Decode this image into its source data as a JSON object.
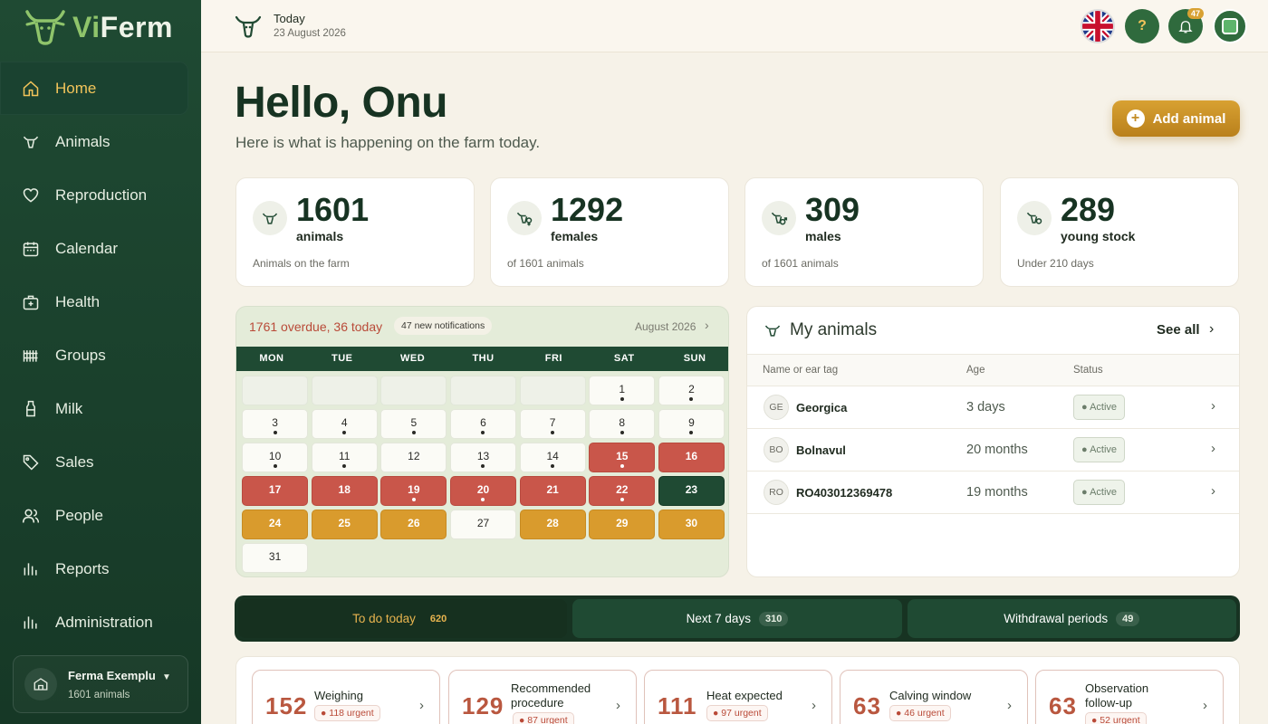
{
  "app": {
    "name_prefix": "Vi",
    "name_suffix": "Ferm"
  },
  "sidebar": {
    "items": [
      {
        "label": "Home",
        "icon": "home-icon"
      },
      {
        "label": "Animals",
        "icon": "cow-icon"
      },
      {
        "label": "Reproduction",
        "icon": "heart-icon"
      },
      {
        "label": "Calendar",
        "icon": "calendar-icon"
      },
      {
        "label": "Health",
        "icon": "medical-kit-icon"
      },
      {
        "label": "Groups",
        "icon": "groups-icon"
      },
      {
        "label": "Milk",
        "icon": "milk-bottle-icon"
      },
      {
        "label": "Sales",
        "icon": "tag-icon"
      },
      {
        "label": "People",
        "icon": "people-icon"
      },
      {
        "label": "Reports",
        "icon": "bar-chart-icon"
      },
      {
        "label": "Administration",
        "icon": "bar-chart-icon"
      }
    ],
    "farm": {
      "name": "Ferma Exemplu",
      "subtitle": "1601 animals"
    }
  },
  "topbar": {
    "today_label": "Today",
    "date": "23 August 2026",
    "notifications_count": "47",
    "help_label": "?"
  },
  "main": {
    "greeting": "Hello, Onu",
    "subtitle": "Here is what is happening on the farm today.",
    "add_animal": "Add animal"
  },
  "stats": [
    {
      "value": "1601",
      "label": "animals",
      "caption": "Animals on the farm",
      "icon": "cow-icon"
    },
    {
      "value": "1292",
      "label": "females",
      "caption": "of 1601 animals",
      "icon": "female-cow-icon"
    },
    {
      "value": "309",
      "label": "males",
      "caption": "of 1601 animals",
      "icon": "male-cow-icon"
    },
    {
      "value": "289",
      "label": "young stock",
      "caption": "Under 210 days",
      "icon": "calf-icon"
    }
  ],
  "calendar": {
    "overdue_text": "1761 overdue, 36 today",
    "notifications_badge": "47 new notifications",
    "month": "August 2026",
    "weekdays": [
      "MON",
      "TUE",
      "WED",
      "THU",
      "FRI",
      "SAT",
      "SUN"
    ],
    "colors": {
      "overdue": "#c9564a",
      "due": "#d99b2d",
      "today": "#1f4a33"
    },
    "days": [
      {
        "d": "",
        "s": "empty"
      },
      {
        "d": "",
        "s": "empty"
      },
      {
        "d": "",
        "s": "empty"
      },
      {
        "d": "",
        "s": "empty"
      },
      {
        "d": "",
        "s": "empty"
      },
      {
        "d": "1",
        "s": "normal",
        "dot": true
      },
      {
        "d": "2",
        "s": "normal",
        "dot": true
      },
      {
        "d": "3",
        "s": "normal",
        "dot": true
      },
      {
        "d": "4",
        "s": "normal",
        "dot": true
      },
      {
        "d": "5",
        "s": "normal",
        "dot": true
      },
      {
        "d": "6",
        "s": "normal",
        "dot": true
      },
      {
        "d": "7",
        "s": "normal",
        "dot": true
      },
      {
        "d": "8",
        "s": "normal",
        "dot": true
      },
      {
        "d": "9",
        "s": "normal",
        "dot": true
      },
      {
        "d": "10",
        "s": "normal",
        "dot": true
      },
      {
        "d": "11",
        "s": "normal",
        "dot": true
      },
      {
        "d": "12",
        "s": "normal"
      },
      {
        "d": "13",
        "s": "normal",
        "dot": true
      },
      {
        "d": "14",
        "s": "normal",
        "dot": true
      },
      {
        "d": "15",
        "s": "over",
        "dot": true
      },
      {
        "d": "16",
        "s": "over"
      },
      {
        "d": "17",
        "s": "over"
      },
      {
        "d": "18",
        "s": "over"
      },
      {
        "d": "19",
        "s": "over",
        "dot": true
      },
      {
        "d": "20",
        "s": "over",
        "dot": true
      },
      {
        "d": "21",
        "s": "over"
      },
      {
        "d": "22",
        "s": "over",
        "dot": true
      },
      {
        "d": "23",
        "s": "today"
      },
      {
        "d": "24",
        "s": "due"
      },
      {
        "d": "25",
        "s": "due"
      },
      {
        "d": "26",
        "s": "due"
      },
      {
        "d": "27",
        "s": "normal"
      },
      {
        "d": "28",
        "s": "due"
      },
      {
        "d": "29",
        "s": "due"
      },
      {
        "d": "30",
        "s": "due"
      },
      {
        "d": "31",
        "s": "normal"
      }
    ]
  },
  "my_animals": {
    "title": "My animals",
    "see_all": "See all",
    "columns": [
      "Name or ear tag",
      "Age",
      "Status"
    ],
    "rows": [
      {
        "initials": "GE",
        "name": "Georgica",
        "age": "3 days",
        "status": "● Active"
      },
      {
        "initials": "BO",
        "name": "Bolnavul",
        "age": "20 months",
        "status": "● Active"
      },
      {
        "initials": "RO",
        "name": "RO403012369478",
        "age": "19 months",
        "status": "● Active"
      }
    ]
  },
  "tabs": [
    {
      "label": "To do today",
      "count": "620",
      "active": true
    },
    {
      "label": "Next 7 days",
      "count": "310"
    },
    {
      "label": "Withdrawal periods",
      "count": "49"
    }
  ],
  "tasks": [
    {
      "count": "152",
      "title": "Weighing",
      "urgent": "● 118 urgent"
    },
    {
      "count": "129",
      "title": "Recommended procedure",
      "urgent": "● 87 urgent"
    },
    {
      "count": "111",
      "title": "Heat expected",
      "urgent": "● 97 urgent"
    },
    {
      "count": "63",
      "title": "Calving window",
      "urgent": "● 46 urgent"
    },
    {
      "count": "63",
      "title": "Observation follow-up",
      "urgent": "● 52 urgent"
    }
  ]
}
